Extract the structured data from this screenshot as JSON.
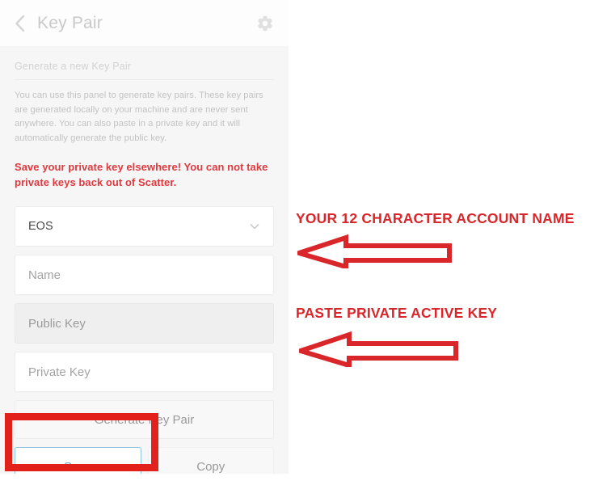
{
  "header": {
    "back_icon": "chevron-left-icon",
    "title": "Key Pair",
    "settings_icon": "gear-icon"
  },
  "panel": {
    "section_label": "Generate a new Key Pair",
    "description": "You can use this panel to generate key pairs. These key pairs are generated locally on your machine and are never sent anywhere. You can also paste in a private key and it will automatically generate the public key.",
    "warning": "Save your private key elsewhere! You can not take private keys back out of Scatter."
  },
  "form": {
    "blockchain_select": {
      "value": "EOS",
      "icon": "chevron-down-icon"
    },
    "name_field": {
      "placeholder": "Name",
      "value": ""
    },
    "public_key_field": {
      "placeholder": "Public Key",
      "value": ""
    },
    "private_key_field": {
      "placeholder": "Private Key",
      "value": ""
    }
  },
  "buttons": {
    "generate": "Generate Key Pair",
    "save": "Save",
    "copy": "Copy"
  },
  "annotations": {
    "color": "#d8262a",
    "highlight_color": "#e2211c",
    "items": [
      {
        "label": "YOUR 12 CHARACTER ACCOUNT NAME",
        "icon": "left-arrow-annotation"
      },
      {
        "label": "PASTE PRIVATE ACTIVE KEY",
        "icon": "left-arrow-annotation"
      }
    ],
    "highlight_target": "save-button"
  },
  "colors": {
    "warning_red": "#e0393e",
    "save_border_blue": "#8fc3de",
    "save_text_blue": "#72a8cc",
    "panel_background": "#f6f6f6"
  }
}
